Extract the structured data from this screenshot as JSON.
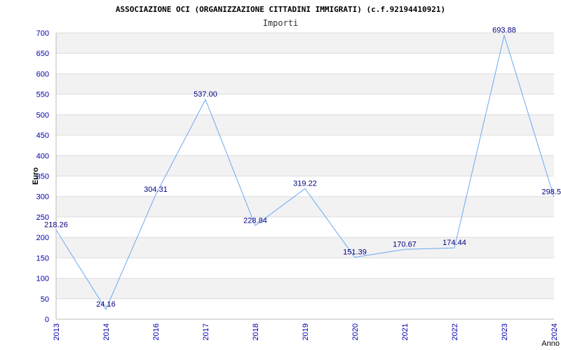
{
  "chart_data": {
    "type": "line",
    "title": "ASSOCIAZIONE OCI (ORGANIZZAZIONE CITTADINI IMMIGRATI) (c.f.92194410921)",
    "subtitle": "Importi",
    "xlabel": "Anno",
    "ylabel": "Euro",
    "ylim": [
      0,
      700
    ],
    "yticks": [
      0,
      50,
      100,
      150,
      200,
      250,
      300,
      350,
      400,
      450,
      500,
      550,
      600,
      650,
      700
    ],
    "grid": true,
    "categories": [
      "2013",
      "2014",
      "2016",
      "2017",
      "2018",
      "2019",
      "2020",
      "2021",
      "2022",
      "2023",
      "2024"
    ],
    "values": [
      218.26,
      24.16,
      304.31,
      537.0,
      228.84,
      319.22,
      151.39,
      170.67,
      174.44,
      693.88,
      298.5
    ],
    "data_labels": [
      "218.26",
      "24.16",
      "304.31",
      "537.00",
      "228.84",
      "319.22",
      "151.39",
      "170.67",
      "174.44",
      "693.88",
      "298.5"
    ],
    "colors": {
      "line": "#6aaaf0",
      "band": "#f2f2f2",
      "grid": "#dddddd",
      "tick_text": "#0000aa",
      "label_text": "#000080"
    }
  }
}
